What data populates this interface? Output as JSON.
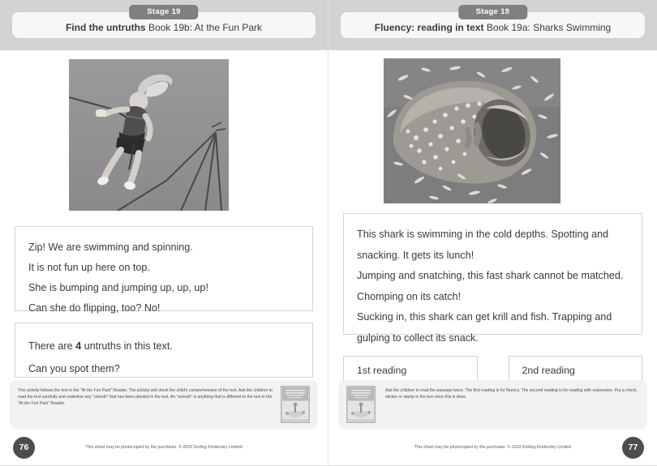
{
  "left_page": {
    "stage_pill": "Stage 19",
    "title_strong": "Find the untruths",
    "title_book": "Book 19b: At the Fun Park",
    "photo_alt": "girl-bungee-trampoline-photo",
    "passage_lines": [
      "Zip! We are swimming and spinning.",
      "It is not fun up here on top.",
      "She is bumping and jumping up, up, up!",
      "Can she do flipping, too? No!"
    ],
    "question_prefix": "There are ",
    "question_count": "4",
    "question_suffix": " untruths in this text.",
    "question_prompt": "Can you spot them?",
    "teacher_note": "This activity follows the text in the \"At the Fun Park\" Reader. The activity will check the child's comprehension of the text. Ask the children to read the text carefully and underline any \"untruth\" that has been planted in the text. An \"untruth\" is anything that is different to the text in the \"At the Fun Park\" Reader.",
    "thumbnail_alt": "at-the-fun-park-book-cover",
    "page_number": "76",
    "copyright": "This sheet may be photocopied by the purchaser. © 2023 Dorling Kindersley Limited"
  },
  "right_page": {
    "stage_pill": "Stage 19",
    "title_strong": "Fluency: reading in text",
    "title_book": "Book 19a: Sharks Swimming",
    "photo_alt": "whale-shark-feeding-photo",
    "passage_paragraphs": [
      "This shark is swimming in the cold depths. Spotting and snacking. It gets its lunch!",
      "Jumping and snatching, this fast shark cannot be matched. Chomping on its catch!",
      "Sucking in, this shark can get krill and fish. Trapping and gulping to collect its snack."
    ],
    "reading_boxes": [
      "1st reading",
      "2nd reading"
    ],
    "teacher_note": "Ask the children to read the passage twice. The first reading is for fluency. The second reading is for reading with expression. Put a check, sticker or stamp in the box once this is done.",
    "thumbnail_alt": "sharks-swimming-book-cover",
    "page_number": "77",
    "copyright": "This sheet may be photocopied by the purchaser. © 2023 Dorling Kindersley Limited"
  },
  "colors": {
    "header_band": "#d3d3d3",
    "stage_pill": "#808080",
    "page_badge": "#4d4d4d",
    "note_panel": "#f2f2f2",
    "box_border": "#d4d4d4"
  }
}
